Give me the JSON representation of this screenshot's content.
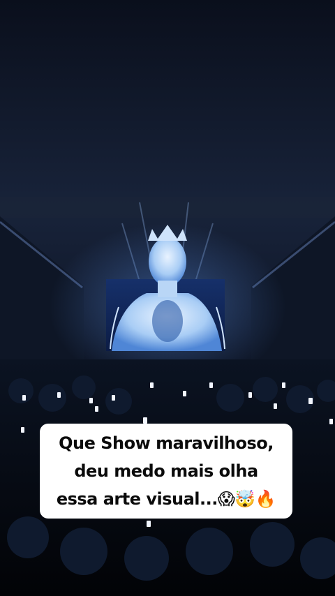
{
  "caption": {
    "line1": "Que Show maravilhoso,",
    "line2": "deu medo mais olha",
    "line3": "essa arte visual...😱🤯🔥"
  },
  "scene": {
    "description_icon": "concert-stage-icon",
    "screen_tint": "#6fb6ff",
    "background": "#05070d"
  }
}
